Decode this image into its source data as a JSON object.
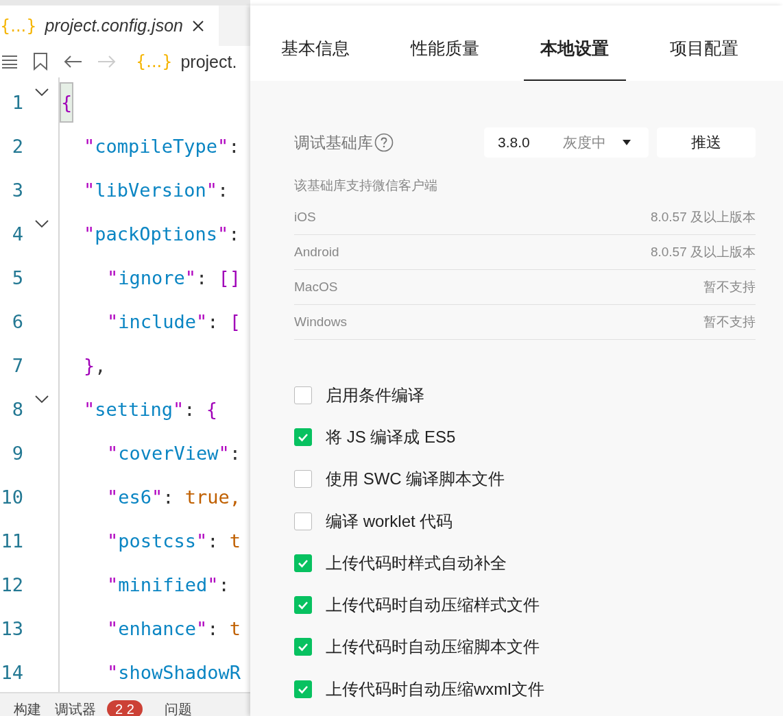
{
  "editor": {
    "tab": {
      "title": "project.config.json",
      "icon_text": "{...}"
    },
    "breadcrumb": {
      "icon_text": "{...}",
      "text": "project."
    },
    "lines": [
      {
        "number": "1",
        "fold": true,
        "kind": "outer",
        "tokens": [
          {
            "kind": "bracket",
            "text": "{"
          }
        ]
      },
      {
        "number": "2",
        "fold": false,
        "kind": "inner",
        "tokens": [
          {
            "kind": "quote",
            "text": "\""
          },
          {
            "kind": "key",
            "text": "compileType"
          },
          {
            "kind": "quote",
            "text": "\""
          },
          {
            "kind": "plain",
            "text": ":"
          }
        ]
      },
      {
        "number": "3",
        "fold": false,
        "kind": "inner",
        "tokens": [
          {
            "kind": "quote",
            "text": "\""
          },
          {
            "kind": "key",
            "text": "libVersion"
          },
          {
            "kind": "quote",
            "text": "\""
          },
          {
            "kind": "plain",
            "text": ":"
          }
        ]
      },
      {
        "number": "4",
        "fold": true,
        "kind": "inner",
        "tokens": [
          {
            "kind": "quote",
            "text": "\""
          },
          {
            "kind": "key",
            "text": "packOptions"
          },
          {
            "kind": "quote",
            "text": "\""
          },
          {
            "kind": "plain",
            "text": ":"
          }
        ]
      },
      {
        "number": "5",
        "fold": false,
        "kind": "nested",
        "tokens": [
          {
            "kind": "quote",
            "text": "\""
          },
          {
            "kind": "key",
            "text": "ignore"
          },
          {
            "kind": "quote",
            "text": "\""
          },
          {
            "kind": "plain",
            "text": ": "
          },
          {
            "kind": "bracket",
            "text": "[]"
          }
        ]
      },
      {
        "number": "6",
        "fold": false,
        "kind": "nested",
        "tokens": [
          {
            "kind": "quote",
            "text": "\""
          },
          {
            "kind": "key",
            "text": "include"
          },
          {
            "kind": "quote",
            "text": "\""
          },
          {
            "kind": "plain",
            "text": ": "
          },
          {
            "kind": "bracket",
            "text": "["
          }
        ]
      },
      {
        "number": "7",
        "fold": false,
        "kind": "inner",
        "tokens": [
          {
            "kind": "bracket",
            "text": "}"
          },
          {
            "kind": "plain",
            "text": ","
          }
        ]
      },
      {
        "number": "8",
        "fold": true,
        "kind": "inner",
        "tokens": [
          {
            "kind": "quote",
            "text": "\""
          },
          {
            "kind": "key",
            "text": "setting"
          },
          {
            "kind": "quote",
            "text": "\""
          },
          {
            "kind": "plain",
            "text": ": "
          },
          {
            "kind": "bracket",
            "text": "{"
          }
        ]
      },
      {
        "number": "9",
        "fold": false,
        "kind": "nested",
        "tokens": [
          {
            "kind": "quote",
            "text": "\""
          },
          {
            "kind": "key",
            "text": "coverView"
          },
          {
            "kind": "quote",
            "text": "\""
          },
          {
            "kind": "plain",
            "text": ":"
          }
        ]
      },
      {
        "number": "10",
        "fold": false,
        "kind": "nested",
        "tokens": [
          {
            "kind": "quote",
            "text": "\""
          },
          {
            "kind": "key",
            "text": "es6"
          },
          {
            "kind": "quote",
            "text": "\""
          },
          {
            "kind": "plain",
            "text": ": "
          },
          {
            "kind": "value",
            "text": "true,"
          }
        ]
      },
      {
        "number": "11",
        "fold": false,
        "kind": "nested",
        "tokens": [
          {
            "kind": "quote",
            "text": "\""
          },
          {
            "kind": "key",
            "text": "postcss"
          },
          {
            "kind": "quote",
            "text": "\""
          },
          {
            "kind": "plain",
            "text": ": "
          },
          {
            "kind": "value",
            "text": "t"
          }
        ]
      },
      {
        "number": "12",
        "fold": false,
        "kind": "nested",
        "tokens": [
          {
            "kind": "quote",
            "text": "\""
          },
          {
            "kind": "key",
            "text": "minified"
          },
          {
            "kind": "quote",
            "text": "\""
          },
          {
            "kind": "plain",
            "text": ":"
          }
        ]
      },
      {
        "number": "13",
        "fold": false,
        "kind": "nested",
        "tokens": [
          {
            "kind": "quote",
            "text": "\""
          },
          {
            "kind": "key",
            "text": "enhance"
          },
          {
            "kind": "quote",
            "text": "\""
          },
          {
            "kind": "plain",
            "text": ": "
          },
          {
            "kind": "value",
            "text": "t"
          }
        ]
      },
      {
        "number": "14",
        "fold": false,
        "kind": "nested",
        "tokens": [
          {
            "kind": "quote",
            "text": "\""
          },
          {
            "kind": "key",
            "text": "showShadowR"
          }
        ]
      }
    ],
    "bottom_tabs": [
      {
        "label": "构建"
      },
      {
        "label": "调试器",
        "badge": "2 2"
      },
      {
        "label": "问题"
      }
    ]
  },
  "panel": {
    "tabs": [
      {
        "label": "基本信息",
        "selected": false
      },
      {
        "label": "性能质量",
        "selected": false
      },
      {
        "label": "本地设置",
        "selected": true
      },
      {
        "label": "项目配置",
        "selected": false
      }
    ],
    "library": {
      "label": "调试基础库",
      "version": "3.8.0",
      "status": "灰度中",
      "button": "推送"
    },
    "support": {
      "title": "该基础库支持微信客户端",
      "rows": [
        {
          "platform": "iOS",
          "value": "8.0.57 及以上版本"
        },
        {
          "platform": "Android",
          "value": "8.0.57 及以上版本"
        },
        {
          "platform": "MacOS",
          "value": "暂不支持"
        },
        {
          "platform": "Windows",
          "value": "暂不支持"
        }
      ]
    },
    "options": [
      {
        "label": "启用条件编译",
        "checked": false
      },
      {
        "label": "将 JS 编译成 ES5",
        "checked": true
      },
      {
        "label": "使用 SWC 编译脚本文件",
        "checked": false
      },
      {
        "label": "编译 worklet 代码",
        "checked": false
      },
      {
        "label": "上传代码时样式自动补全",
        "checked": true
      },
      {
        "label": "上传代码时自动压缩样式文件",
        "checked": true
      },
      {
        "label": "上传代码时自动压缩脚本文件",
        "checked": true
      },
      {
        "label": "上传代码时自动压缩wxml文件",
        "checked": true
      }
    ]
  }
}
